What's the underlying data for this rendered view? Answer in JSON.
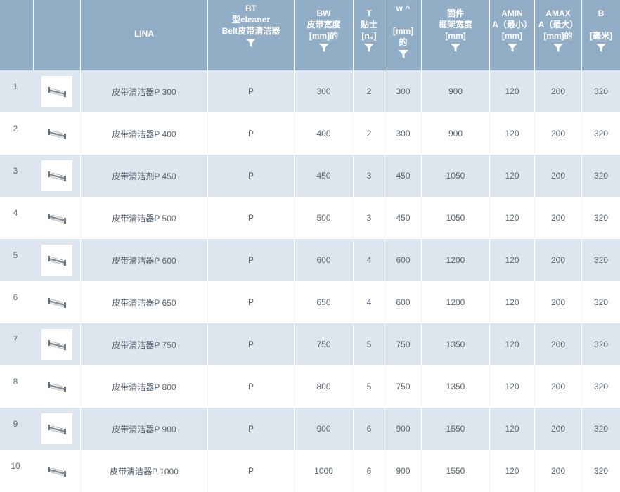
{
  "header": {
    "col_name": "LINA",
    "col_bt": "BT\n型cleaner\nBelt皮带清洁器",
    "col_bw": "BW\n皮带宽度\n[mm]的",
    "col_t": "T\n贴士\n[n。]",
    "col_w": "w ^\n\n[mm]\n的",
    "col_frame": "固件\n框架宽度\n[mm]",
    "col_amin": "AMIN\nA（最小）\n[mm]",
    "col_amax": "AMAX\nA（最大）\n[mm]的",
    "col_b": "B\n\n[毫米]"
  },
  "rows": [
    {
      "num": "1",
      "name": "皮带清洁器P 300",
      "bt": "P",
      "bw": "300",
      "t": "2",
      "w": "300",
      "frame": "900",
      "amin": "120",
      "amax": "200",
      "b": "320"
    },
    {
      "num": "2",
      "name": "皮带清洁器P 400",
      "bt": "P",
      "bw": "400",
      "t": "2",
      "w": "300",
      "frame": "900",
      "amin": "120",
      "amax": "200",
      "b": "320"
    },
    {
      "num": "3",
      "name": "皮带清洁剂P 450",
      "bt": "P",
      "bw": "450",
      "t": "3",
      "w": "450",
      "frame": "1050",
      "amin": "120",
      "amax": "200",
      "b": "320"
    },
    {
      "num": "4",
      "name": "皮带清洁器P 500",
      "bt": "P",
      "bw": "500",
      "t": "3",
      "w": "450",
      "frame": "1050",
      "amin": "120",
      "amax": "200",
      "b": "320"
    },
    {
      "num": "5",
      "name": "皮带清洁器P 600",
      "bt": "P",
      "bw": "600",
      "t": "4",
      "w": "600",
      "frame": "1200",
      "amin": "120",
      "amax": "200",
      "b": "320"
    },
    {
      "num": "6",
      "name": "皮带清洁器P 650",
      "bt": "P",
      "bw": "650",
      "t": "4",
      "w": "600",
      "frame": "1200",
      "amin": "120",
      "amax": "200",
      "b": "320"
    },
    {
      "num": "7",
      "name": "皮带清洁器P 750",
      "bt": "P",
      "bw": "750",
      "t": "5",
      "w": "750",
      "frame": "1350",
      "amin": "120",
      "amax": "200",
      "b": "320"
    },
    {
      "num": "8",
      "name": "皮带清洁器P 800",
      "bt": "P",
      "bw": "800",
      "t": "5",
      "w": "750",
      "frame": "1350",
      "amin": "120",
      "amax": "200",
      "b": "320"
    },
    {
      "num": "9",
      "name": "皮带清洁器P 900",
      "bt": "P",
      "bw": "900",
      "t": "6",
      "w": "900",
      "frame": "1550",
      "amin": "120",
      "amax": "200",
      "b": "320"
    },
    {
      "num": "10",
      "name": "皮带清洁器P 1000",
      "bt": "P",
      "bw": "1000",
      "t": "6",
      "w": "900",
      "frame": "1550",
      "amin": "120",
      "amax": "200",
      "b": "320"
    }
  ],
  "icons": {
    "filter": "filter-icon",
    "thumbnail": "belt-cleaner-thumbnail"
  },
  "colors": {
    "header_bg": "#92aec7",
    "row_alt_bg": "#dde6ef",
    "text": "#5a6470"
  }
}
